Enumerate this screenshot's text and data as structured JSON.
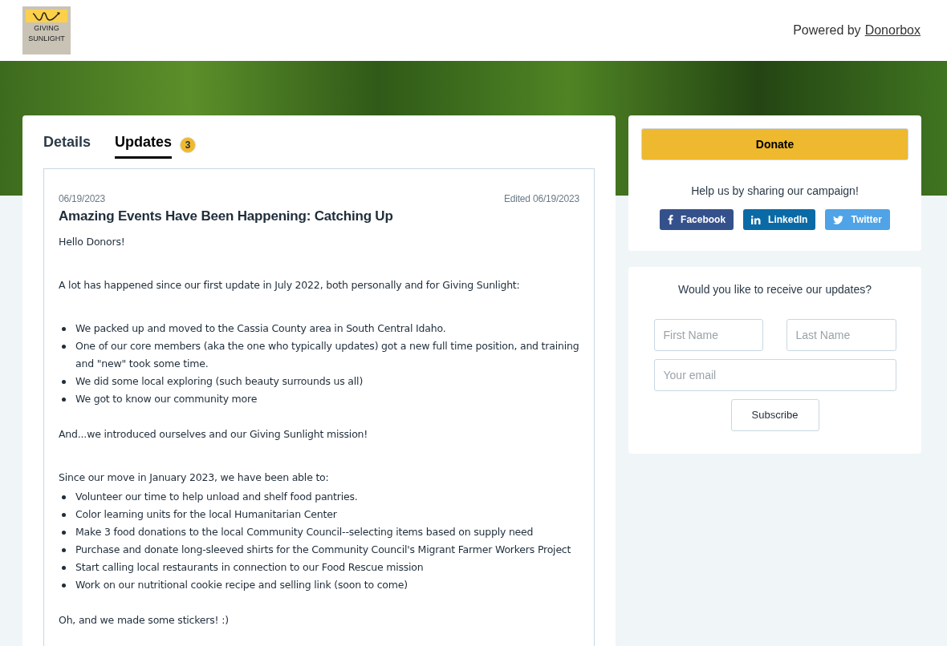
{
  "header": {
    "logo_text": [
      "GIVING",
      "SUNLIGHT"
    ],
    "powered_by": "Powered by",
    "powered_link": "Donorbox"
  },
  "tabs": [
    {
      "label": "Details",
      "selected": false
    },
    {
      "label": "Updates",
      "selected": true,
      "count": "3"
    }
  ],
  "update": {
    "date": "06/19/2023",
    "edited": "Edited 06/19/2023",
    "title": "Amazing Events Have Been Happening: Catching Up",
    "blocks": [
      {
        "kind": "paragraph",
        "text": "Hello Donors!"
      },
      {
        "kind": "paragraph",
        "text": "A lot has happened since our first update in July 2022, both personally and for Giving Sunlight:"
      },
      {
        "kind": "list",
        "items": [
          "We packed up and moved to the Cassia County area in South Central Idaho.",
          "One of our core members (aka the one who typically updates) got a new full time position, and training and \"new\" took some time.",
          "We did some local exploring (such beauty surrounds us all)",
          "We got to know our community more"
        ]
      },
      {
        "kind": "paragraph",
        "text": "And...we introduced ourselves and our Giving Sunlight mission!"
      },
      {
        "kind": "lead",
        "text": "Since our move in January 2023, we have been able to:"
      },
      {
        "kind": "list",
        "items": [
          "Volunteer our time to help unload and shelf food pantries.",
          "Color learning units for the local Humanitarian Center",
          "Make 3 food donations to the local Community Council--selecting items based on supply need",
          "Purchase and donate long-sleeved shirts for the Community Council's Migrant Farmer Workers Project",
          "Start calling local restaurants in connection to our Food Rescue mission",
          "Work on our nutritional cookie recipe and selling link (soon to come)"
        ]
      },
      {
        "kind": "paragraph",
        "text": "Oh, and we made some stickers! :)"
      }
    ]
  },
  "donate": {
    "button": "Donate",
    "share_text": "Help us by sharing our campaign!",
    "share_buttons": [
      {
        "kind": "facebook",
        "label": "Facebook",
        "color": "#35518c"
      },
      {
        "kind": "linkedin",
        "label": "LinkedIn",
        "color": "#0a6aa6"
      },
      {
        "kind": "twitter",
        "label": "Twitter",
        "color": "#4fa3e6"
      }
    ]
  },
  "subscribe": {
    "title": "Would you like to receive our updates?",
    "first_name": {
      "placeholder": "First Name"
    },
    "last_name": {
      "placeholder": "Last Name"
    },
    "email": {
      "placeholder": "Your email"
    },
    "button": "Subscribe"
  }
}
